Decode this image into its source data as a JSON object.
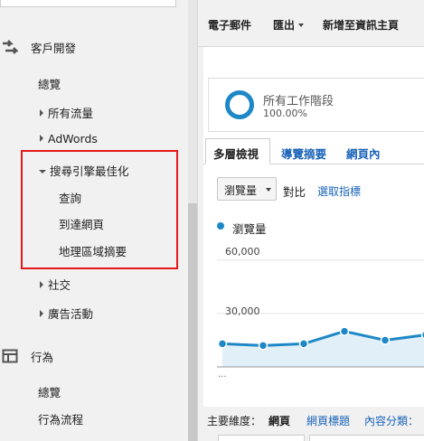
{
  "sidebar": {
    "sections": [
      {
        "label": "客戶開發",
        "icon": "acquisition-arrows-icon"
      },
      {
        "label": "行為",
        "icon": "behavior-layout-icon"
      }
    ],
    "acquisition": {
      "overview": "總覽",
      "all_traffic": "所有流量",
      "adwords": "AdWords",
      "seo": "搜尋引擎最佳化",
      "seo_items": [
        "查詢",
        "到達網頁",
        "地理區域摘要"
      ],
      "social": "社交",
      "campaigns": "廣告活動"
    },
    "behavior": {
      "overview": "總覽",
      "flow": "行為流程"
    }
  },
  "toolbar": {
    "email": "電子郵件",
    "export": "匯出",
    "add_dashboard": "新增至資訊主頁"
  },
  "segment": {
    "name": "所有工作階段",
    "percent": "100.00%"
  },
  "tabs": [
    "多層檢視",
    "導覽摘要",
    "網頁內"
  ],
  "controls": {
    "metric": "瀏覽量",
    "vs": "對比",
    "pick_metric": "選取指標"
  },
  "chart_data": {
    "type": "area",
    "series": [
      {
        "name": "瀏覽量",
        "values": [
          13000,
          12000,
          13000,
          20000,
          15000,
          18000
        ]
      }
    ],
    "yticks": [
      "60,000",
      "30,000"
    ],
    "ylim": [
      0,
      66000
    ],
    "color": "#1e88c7"
  },
  "dimensions": {
    "label": "主要維度：",
    "active": "網頁",
    "links": [
      "網頁標題",
      "內容分類："
    ]
  },
  "colors": {
    "highlight": "#e3191c",
    "link": "#1a63b8",
    "accent": "#1e88c7"
  }
}
